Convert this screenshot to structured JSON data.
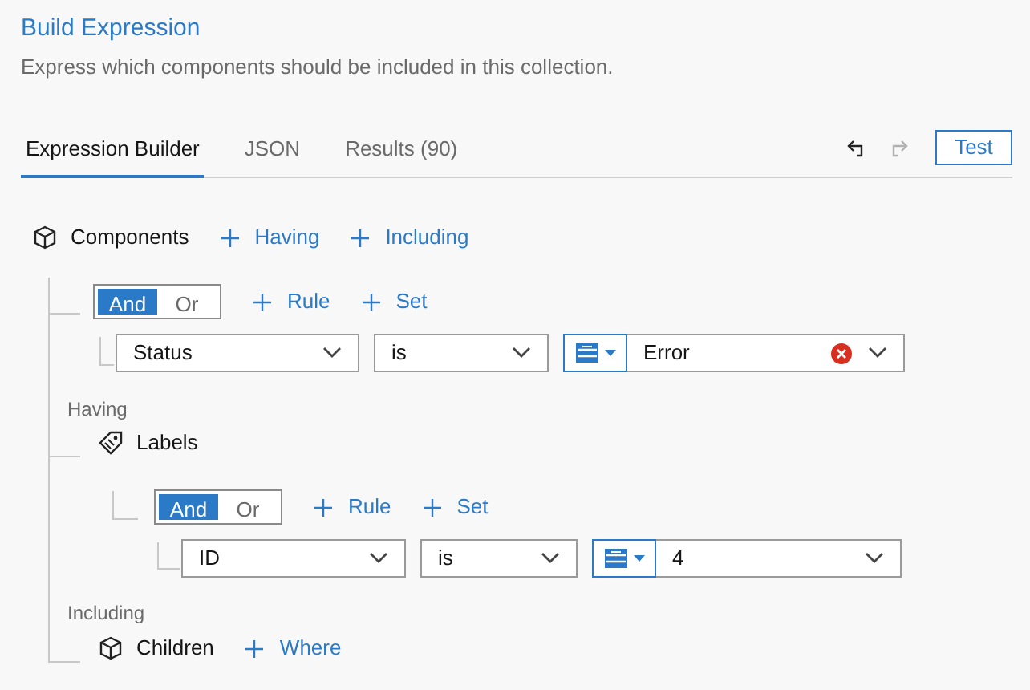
{
  "title": "Build Expression",
  "description": "Express which components should be included in this collection.",
  "tabs": [
    {
      "label": "Expression Builder",
      "selected": true
    },
    {
      "label": "JSON",
      "selected": false
    },
    {
      "label": "Results (90)",
      "selected": false
    }
  ],
  "undo": {
    "disabled": false
  },
  "redo": {
    "disabled": true
  },
  "test_button": "Test",
  "root": {
    "label": "Components",
    "actions": [
      "Having",
      "Including"
    ],
    "where": {
      "operators": [
        {
          "label": "And",
          "selected": true
        },
        {
          "label": "Or",
          "selected": false
        }
      ],
      "actions": [
        "Rule",
        "Set"
      ],
      "rules": [
        {
          "field": "Status",
          "operator": "is",
          "value": "Error",
          "clearable": true
        }
      ]
    }
  },
  "sections": [
    {
      "heading": "Having",
      "kind": "labels",
      "label": "Labels",
      "where": {
        "operators": [
          {
            "label": "And",
            "selected": true
          },
          {
            "label": "Or",
            "selected": false
          }
        ],
        "actions": [
          "Rule",
          "Set"
        ],
        "rules": [
          {
            "field": "ID",
            "operator": "is",
            "value": "4",
            "clearable": false
          }
        ]
      }
    },
    {
      "heading": "Including",
      "kind": "children",
      "label": "Children",
      "actions": [
        "Where"
      ]
    }
  ]
}
